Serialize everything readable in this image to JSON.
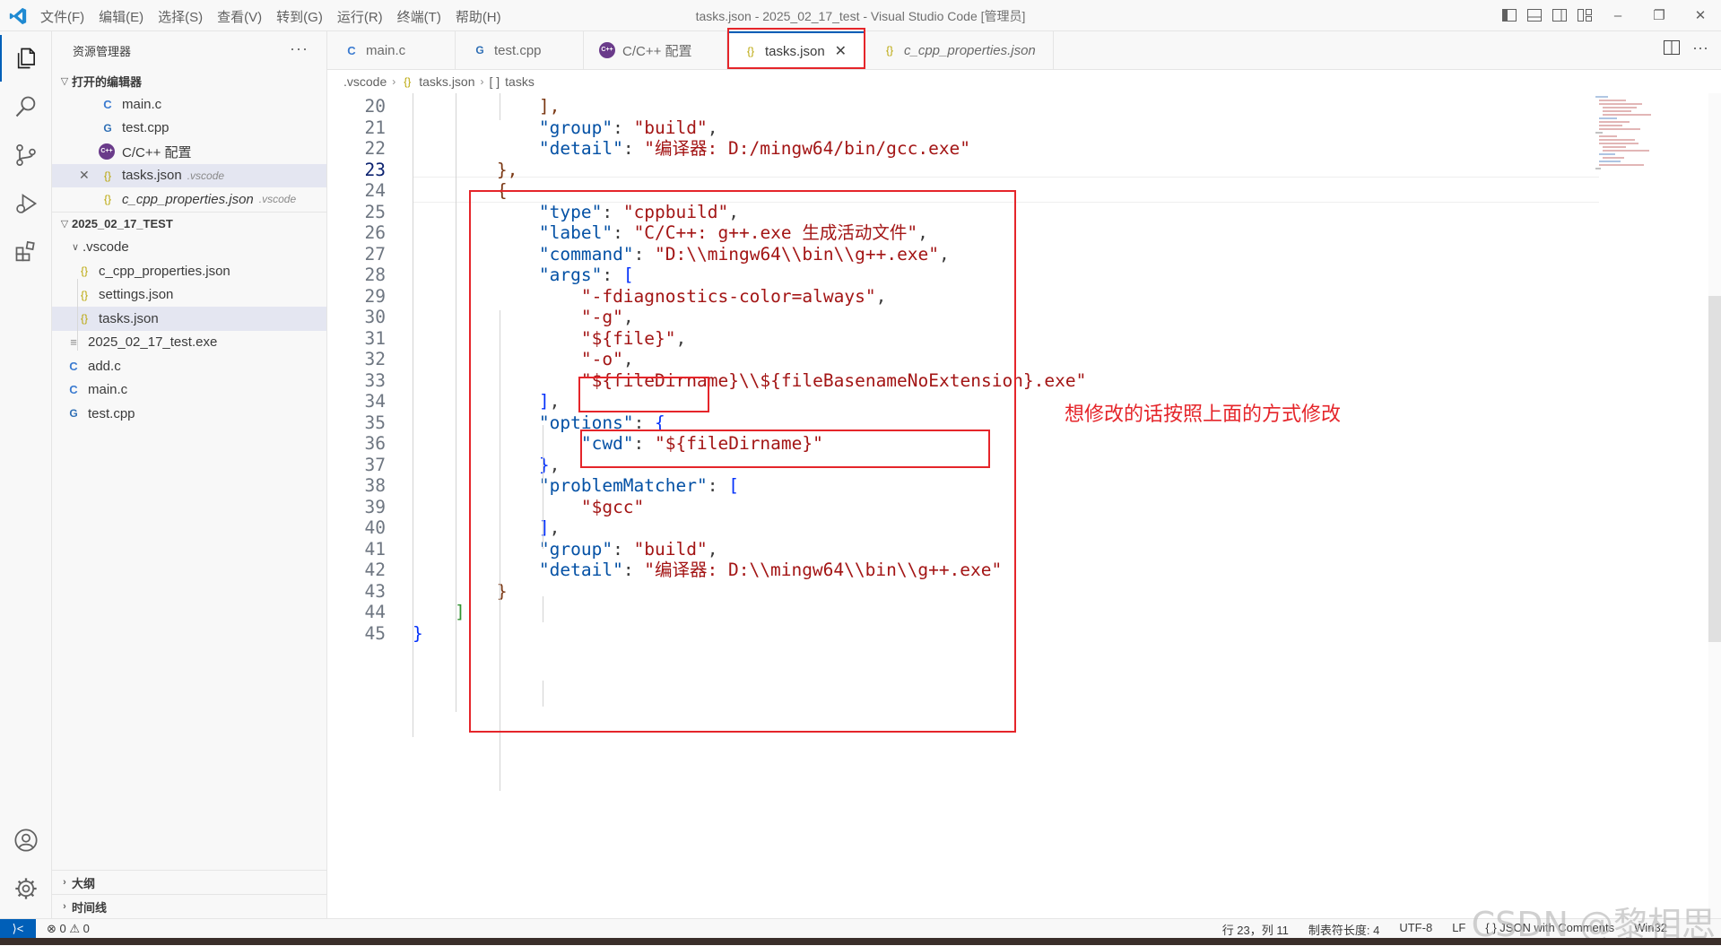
{
  "window": {
    "title": "tasks.json - 2025_02_17_test - Visual Studio Code [管理员]",
    "menu": [
      "文件(F)",
      "编辑(E)",
      "选择(S)",
      "查看(V)",
      "转到(G)",
      "运行(R)",
      "终端(T)",
      "帮助(H)"
    ]
  },
  "sidebar": {
    "title": "资源管理器",
    "more": "···",
    "open_editors": {
      "label": "打开的编辑器",
      "items": [
        {
          "icon": "C",
          "name": "main.c"
        },
        {
          "icon": "G",
          "name": "test.cpp"
        },
        {
          "icon": "C++",
          "name": "C/C++ 配置"
        },
        {
          "icon": "{}",
          "name": "tasks.json",
          "dir": ".vscode"
        },
        {
          "icon": "{}",
          "name": "c_cpp_properties.json",
          "dir": ".vscode"
        }
      ]
    },
    "workspace": {
      "label": "2025_02_17_TEST",
      "folder": ".vscode",
      "items": [
        {
          "icon": "{}",
          "name": "c_cpp_properties.json"
        },
        {
          "icon": "{}",
          "name": "settings.json"
        },
        {
          "icon": "{}",
          "name": "tasks.json"
        },
        {
          "icon": "≡",
          "name": "2025_02_17_test.exe"
        },
        {
          "icon": "C",
          "name": "add.c"
        },
        {
          "icon": "C",
          "name": "main.c"
        },
        {
          "icon": "G",
          "name": "test.cpp"
        }
      ]
    },
    "outline": "大纲",
    "timeline": "时间线"
  },
  "tabs": [
    {
      "icon": "C",
      "label": "main.c"
    },
    {
      "icon": "G",
      "label": "test.cpp"
    },
    {
      "icon": "C++",
      "label": "C/C++ 配置"
    },
    {
      "icon": "{}",
      "label": "tasks.json",
      "close": "✕"
    },
    {
      "icon": "{}",
      "label": "c_cpp_properties.json"
    }
  ],
  "breadcrumb": [
    ".vscode",
    "tasks.json",
    "tasks"
  ],
  "breadcrumb_icons": [
    "{}",
    "[ ]"
  ],
  "editor": {
    "lines": [
      {
        "n": "20",
        "parts": [
          [
            "p",
            "            "
          ],
          [
            "b3",
            "],"
          ]
        ]
      },
      {
        "n": "21",
        "parts": [
          [
            "p",
            "            "
          ],
          [
            "k",
            "\"group\""
          ],
          [
            "p",
            ": "
          ],
          [
            "s",
            "\"build\""
          ],
          [
            "p",
            ","
          ]
        ]
      },
      {
        "n": "22",
        "parts": [
          [
            "p",
            "            "
          ],
          [
            "k",
            "\"detail\""
          ],
          [
            "p",
            ": "
          ],
          [
            "s",
            "\"编译器: D:/mingw64/bin/gcc.exe\""
          ]
        ]
      },
      {
        "n": "23",
        "parts": [
          [
            "p",
            "        "
          ],
          [
            "b3",
            "},"
          ]
        ]
      },
      {
        "n": "24",
        "parts": [
          [
            "p",
            "        "
          ],
          [
            "b3",
            "{"
          ]
        ]
      },
      {
        "n": "25",
        "parts": [
          [
            "p",
            "            "
          ],
          [
            "k",
            "\"type\""
          ],
          [
            "p",
            ": "
          ],
          [
            "s",
            "\"cppbuild\""
          ],
          [
            "p",
            ","
          ]
        ]
      },
      {
        "n": "26",
        "parts": [
          [
            "p",
            "            "
          ],
          [
            "k",
            "\"label\""
          ],
          [
            "p",
            ": "
          ],
          [
            "s",
            "\"C/C++: g++.exe 生成活动文件\""
          ],
          [
            "p",
            ","
          ]
        ]
      },
      {
        "n": "27",
        "parts": [
          [
            "p",
            "            "
          ],
          [
            "k",
            "\"command\""
          ],
          [
            "p",
            ": "
          ],
          [
            "s",
            "\"D:\\\\mingw64\\\\bin\\\\g++.exe\""
          ],
          [
            "p",
            ","
          ]
        ]
      },
      {
        "n": "28",
        "parts": [
          [
            "p",
            "            "
          ],
          [
            "k",
            "\"args\""
          ],
          [
            "p",
            ": "
          ],
          [
            "b1",
            "["
          ]
        ]
      },
      {
        "n": "29",
        "parts": [
          [
            "p",
            "                "
          ],
          [
            "s",
            "\"-fdiagnostics-color=always\""
          ],
          [
            "p",
            ","
          ]
        ]
      },
      {
        "n": "30",
        "parts": [
          [
            "p",
            "                "
          ],
          [
            "s",
            "\"-g\""
          ],
          [
            "p",
            ","
          ]
        ]
      },
      {
        "n": "31",
        "parts": [
          [
            "p",
            "                "
          ],
          [
            "s",
            "\"${file}\""
          ],
          [
            "p",
            ","
          ]
        ]
      },
      {
        "n": "32",
        "parts": [
          [
            "p",
            "                "
          ],
          [
            "s",
            "\"-o\""
          ],
          [
            "p",
            ","
          ]
        ]
      },
      {
        "n": "33",
        "parts": [
          [
            "p",
            "                "
          ],
          [
            "s",
            "\"${fileDirname}\\\\${fileBasenameNoExtension}.exe\""
          ]
        ]
      },
      {
        "n": "34",
        "parts": [
          [
            "p",
            "            "
          ],
          [
            "b1",
            "]"
          ],
          [
            "p",
            ","
          ]
        ]
      },
      {
        "n": "35",
        "parts": [
          [
            "p",
            "            "
          ],
          [
            "k",
            "\"options\""
          ],
          [
            "p",
            ": "
          ],
          [
            "b1",
            "{"
          ]
        ]
      },
      {
        "n": "36",
        "parts": [
          [
            "p",
            "                "
          ],
          [
            "k",
            "\"cwd\""
          ],
          [
            "p",
            ": "
          ],
          [
            "s",
            "\"${fileDirname}\""
          ]
        ]
      },
      {
        "n": "37",
        "parts": [
          [
            "p",
            "            "
          ],
          [
            "b1",
            "}"
          ],
          [
            "p",
            ","
          ]
        ]
      },
      {
        "n": "38",
        "parts": [
          [
            "p",
            "            "
          ],
          [
            "k",
            "\"problemMatcher\""
          ],
          [
            "p",
            ": "
          ],
          [
            "b1",
            "["
          ]
        ]
      },
      {
        "n": "39",
        "parts": [
          [
            "p",
            "                "
          ],
          [
            "s",
            "\"$gcc\""
          ]
        ]
      },
      {
        "n": "40",
        "parts": [
          [
            "p",
            "            "
          ],
          [
            "b1",
            "]"
          ],
          [
            "p",
            ","
          ]
        ]
      },
      {
        "n": "41",
        "parts": [
          [
            "p",
            "            "
          ],
          [
            "k",
            "\"group\""
          ],
          [
            "p",
            ": "
          ],
          [
            "s",
            "\"build\""
          ],
          [
            "p",
            ","
          ]
        ]
      },
      {
        "n": "42",
        "parts": [
          [
            "p",
            "            "
          ],
          [
            "k",
            "\"detail\""
          ],
          [
            "p",
            ": "
          ],
          [
            "s",
            "\"编译器: D:\\\\mingw64\\\\bin\\\\g++.exe\""
          ]
        ]
      },
      {
        "n": "43",
        "parts": [
          [
            "p",
            "        "
          ],
          [
            "b3",
            "}"
          ]
        ]
      },
      {
        "n": "44",
        "parts": [
          [
            "p",
            "    "
          ],
          [
            "b2",
            "]"
          ]
        ]
      },
      {
        "n": "45",
        "parts": [
          [
            "b1",
            "}"
          ]
        ]
      }
    ],
    "annotation": "想修改的话按照上面的方式修改"
  },
  "status": {
    "remote": "⟩<",
    "problems": "0",
    "warnings": "0",
    "position": "行 23，列 11",
    "tab_size": "制表符长度: 4",
    "encoding": "UTF-8",
    "eol": "LF",
    "language": "{ } JSON with Comments",
    "platform": "Win32"
  },
  "watermark": "CSDN @黎相思",
  "colors": {
    "accent": "#005fb8",
    "annotation": "#e5252a"
  }
}
